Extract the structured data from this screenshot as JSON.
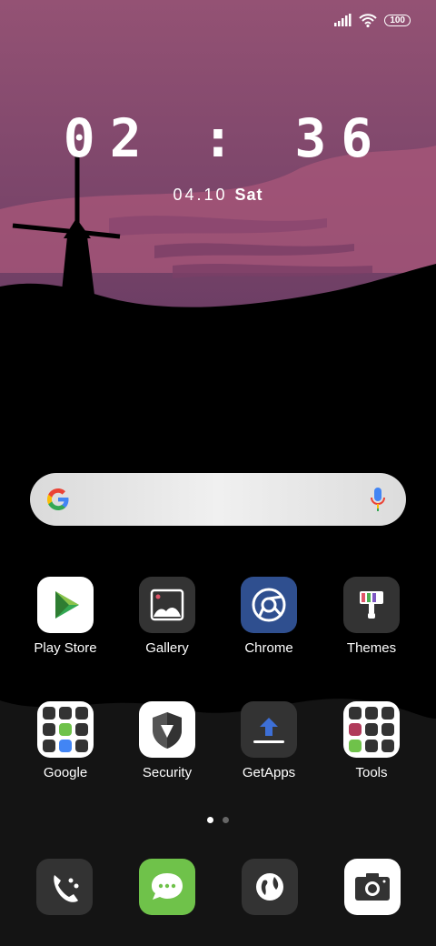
{
  "status": {
    "battery": "100"
  },
  "lockscreen": {
    "time": "02 : 36",
    "date": "04.10",
    "day": "Sat"
  },
  "search": {
    "google_letter": "G"
  },
  "apps_row1": [
    {
      "label": "Play Store"
    },
    {
      "label": "Gallery"
    },
    {
      "label": "Chrome"
    },
    {
      "label": "Themes"
    }
  ],
  "apps_row2": [
    {
      "label": "Google"
    },
    {
      "label": "Security"
    },
    {
      "label": "GetApps"
    },
    {
      "label": "Tools"
    }
  ],
  "pages": {
    "count": 2,
    "active": 1
  },
  "dock": [
    "phone-icon",
    "messages-icon",
    "browser-icon",
    "camera-icon"
  ],
  "colors": {
    "sky_top": "#8e4f72",
    "sky_bottom": "#b06a8a",
    "accent_green": "#6fc24a",
    "chrome_blue": "#2f4f8f"
  }
}
